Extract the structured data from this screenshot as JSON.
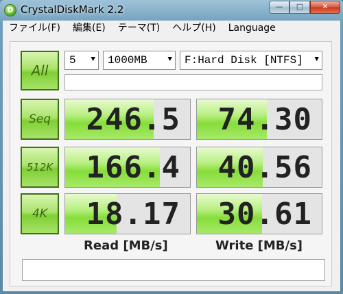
{
  "window": {
    "title": "CrystalDiskMark 2.2",
    "app_icon": "D"
  },
  "caption_buttons": {
    "minimize": "—",
    "maximize": "□",
    "close": "✕"
  },
  "menu": [
    {
      "label": "ファイル(F)"
    },
    {
      "label": "編集(E)"
    },
    {
      "label": "テーマ(T)"
    },
    {
      "label": "ヘルプ(H)"
    },
    {
      "label": "Language"
    }
  ],
  "controls": {
    "all_label": "All",
    "count": "5",
    "size": "1000MB",
    "drive": "F:Hard Disk [NTFS]"
  },
  "rows": [
    {
      "label": "Seq",
      "read": {
        "value": "246.5",
        "fill": 0.71
      },
      "write": {
        "value": "74.30",
        "fill": 0.56
      }
    },
    {
      "label": "512K",
      "read": {
        "value": "166.4",
        "fill": 0.76
      },
      "write": {
        "value": "40.56",
        "fill": 0.53
      }
    },
    {
      "label": "4K",
      "read": {
        "value": "18.17",
        "fill": 0.41
      },
      "write": {
        "value": "30.61",
        "fill": 0.52
      }
    }
  ],
  "columns": {
    "read": "Read [MB/s]",
    "write": "Write [MB/s]"
  },
  "colors": {
    "accent_green": "#86dd3a",
    "button_border": "#3f6f16",
    "title_gradient": "#6f9fbc"
  }
}
